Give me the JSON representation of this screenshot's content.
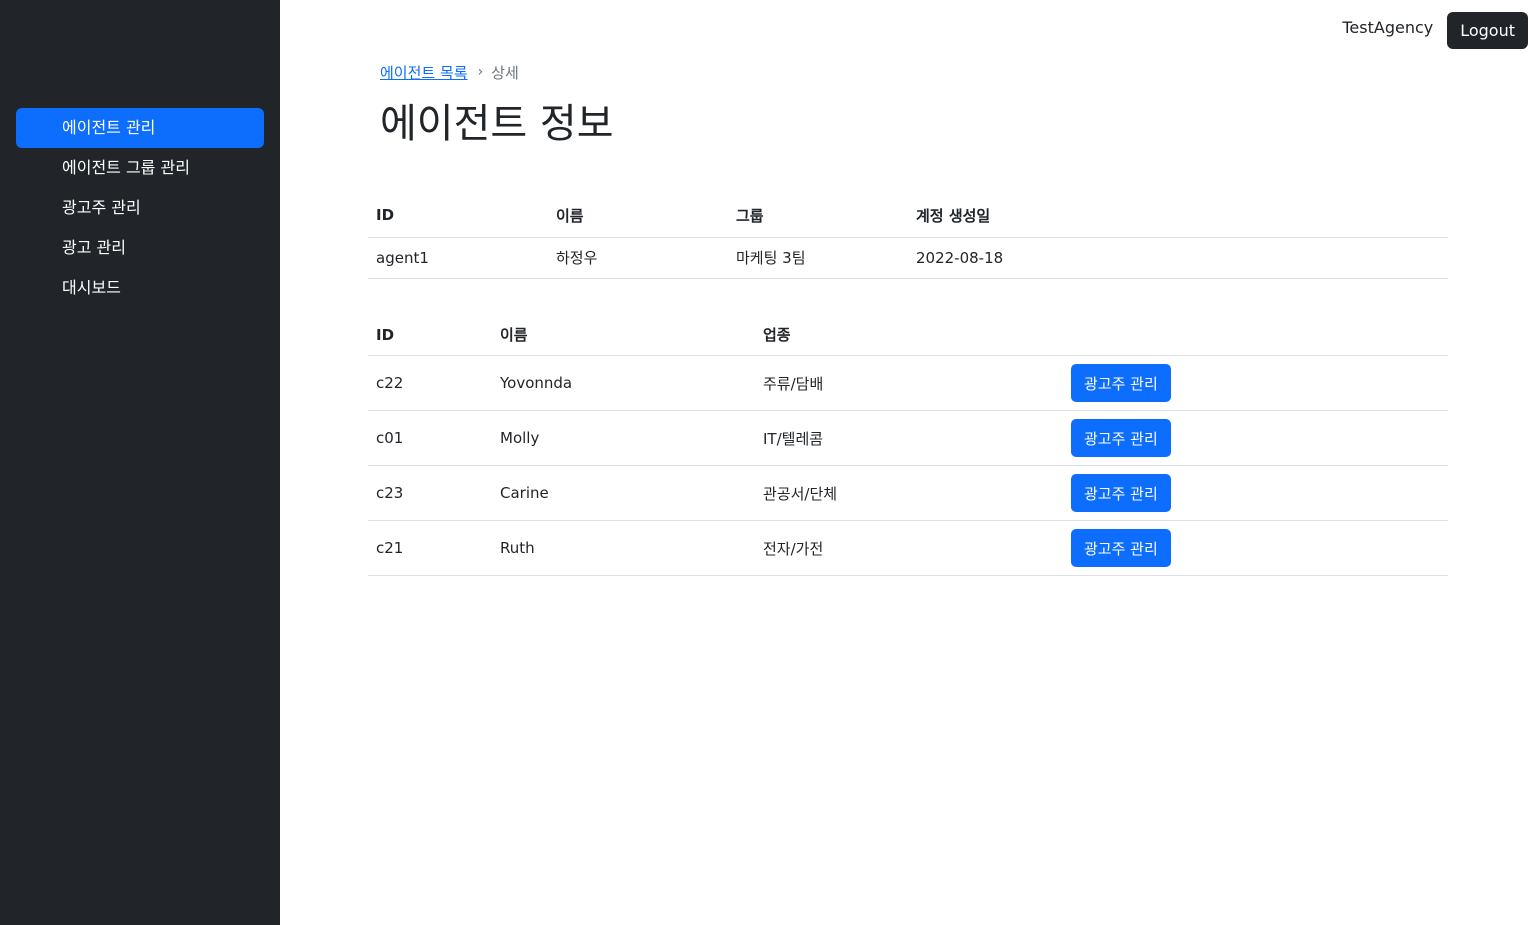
{
  "sidebar": {
    "items": [
      {
        "label": "에이전트 관리",
        "active": true
      },
      {
        "label": "에이전트 그룹 관리",
        "active": false
      },
      {
        "label": "광고주 관리",
        "active": false
      },
      {
        "label": "광고 관리",
        "active": false
      },
      {
        "label": "대시보드",
        "active": false
      }
    ]
  },
  "header": {
    "user": "TestAgency",
    "logout_label": "Logout"
  },
  "breadcrumb": {
    "link": "에이전트 목록",
    "current": "상세"
  },
  "page_title": "에이전트 정보",
  "agent_table": {
    "headers": [
      "ID",
      "이름",
      "그룹",
      "계정 생성일"
    ],
    "row": [
      "agent1",
      "하정우",
      "마케팅 3팀",
      "2022-08-18"
    ]
  },
  "client_table": {
    "headers": [
      "ID",
      "이름",
      "업종",
      ""
    ],
    "button_label": "광고주 관리",
    "rows": [
      [
        "c22",
        "Yovonnda",
        "주류/담배"
      ],
      [
        "c01",
        "Molly",
        "IT/텔레콤"
      ],
      [
        "c23",
        "Carine",
        "관공서/단체"
      ],
      [
        "c21",
        "Ruth",
        "전자/가전"
      ]
    ]
  },
  "colors": {
    "sidebar_bg": "#212529",
    "accent": "#0d6efd"
  }
}
